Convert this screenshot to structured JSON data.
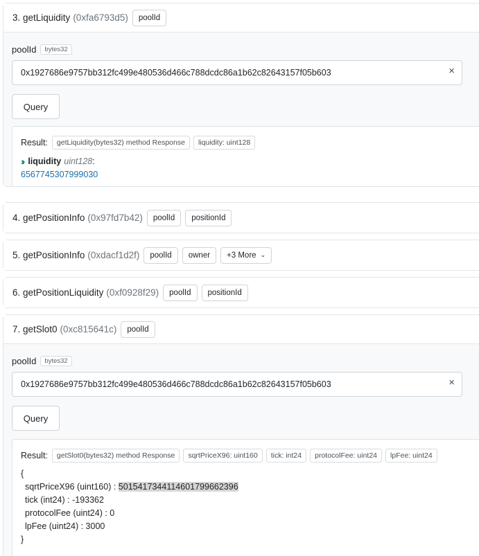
{
  "card3": {
    "name": "3. getLiquidity",
    "selector": "(0xfa6793d5)",
    "tags": [
      "poolId"
    ],
    "param_label": "poolId",
    "param_type": "bytes32",
    "input_value": "0x1927686e9757bb312fc499e480536d466c788dcdc86a1b62c82643157f05b603",
    "clear_symbol": "×",
    "query_label": "Query",
    "result_label": "Result:",
    "result_tags": [
      "getLiquidity(bytes32) method Response",
      "liquidity: uint128"
    ],
    "output_name": "liquidity",
    "output_type": "uint128",
    "output_colon": ":",
    "output_value": "6567745307999030"
  },
  "card4": {
    "name": "4. getPositionInfo",
    "selector": "(0x97fd7b42)",
    "tags": [
      "poolId",
      "positionId"
    ]
  },
  "card5": {
    "name": "5. getPositionInfo",
    "selector": "(0xdacf1d2f)",
    "tags": [
      "poolId",
      "owner"
    ],
    "more_label": "+3 More"
  },
  "card6": {
    "name": "6. getPositionLiquidity",
    "selector": "(0xf0928f29)",
    "tags": [
      "poolId",
      "positionId"
    ]
  },
  "card7": {
    "name": "7. getSlot0",
    "selector": "(0xc815641c)",
    "tags": [
      "poolId"
    ],
    "param_label": "poolId",
    "param_type": "bytes32",
    "input_value": "0x1927686e9757bb312fc499e480536d466c788dcdc86a1b62c82643157f05b603",
    "clear_symbol": "×",
    "query_label": "Query",
    "result_label": "Result:",
    "result_tags": [
      "getSlot0(bytes32) method Response",
      "sqrtPriceX96: uint160",
      "tick: int24",
      "protocolFee: uint24",
      "lpFee: uint24"
    ],
    "json_open": "{",
    "json_close": "}",
    "fields": [
      {
        "key": "sqrtPriceX96 (uint160) : ",
        "value": "5015417344114601799662396"
      },
      {
        "key": "tick (int24) : ",
        "value": "-193362"
      },
      {
        "key": "protocolFee (uint24) : ",
        "value": "0"
      },
      {
        "key": "lpFee (uint24) : ",
        "value": "3000"
      }
    ]
  },
  "icons": {
    "chevron_down": "chevron-down-icon",
    "double_chevron": "double-chevron-right-icon",
    "clear": "close-icon"
  },
  "colors": {
    "output_value": "#1a6fa8",
    "chevron_accent": "#12877e",
    "selected_highlight": "#d5d5d5"
  }
}
